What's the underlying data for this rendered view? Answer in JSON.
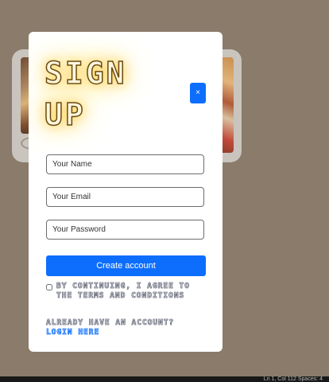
{
  "modal": {
    "title_line1": "SIGN",
    "title_line2": "UP",
    "close_label": "×",
    "name_placeholder": "Your Name",
    "email_placeholder": "Your Email",
    "password_placeholder": "Your Password",
    "submit_label": "Create account",
    "terms_text": "By continuing, I agree to the terms and conditions",
    "already_text": "Already have an account?",
    "login_text": "Login here"
  },
  "statusbar": {
    "text": "Ln 1, Col 112    Spaces: 4"
  },
  "colors": {
    "background": "#8a7b6b",
    "accent": "#0d6efd",
    "modal": "#ffffff"
  }
}
